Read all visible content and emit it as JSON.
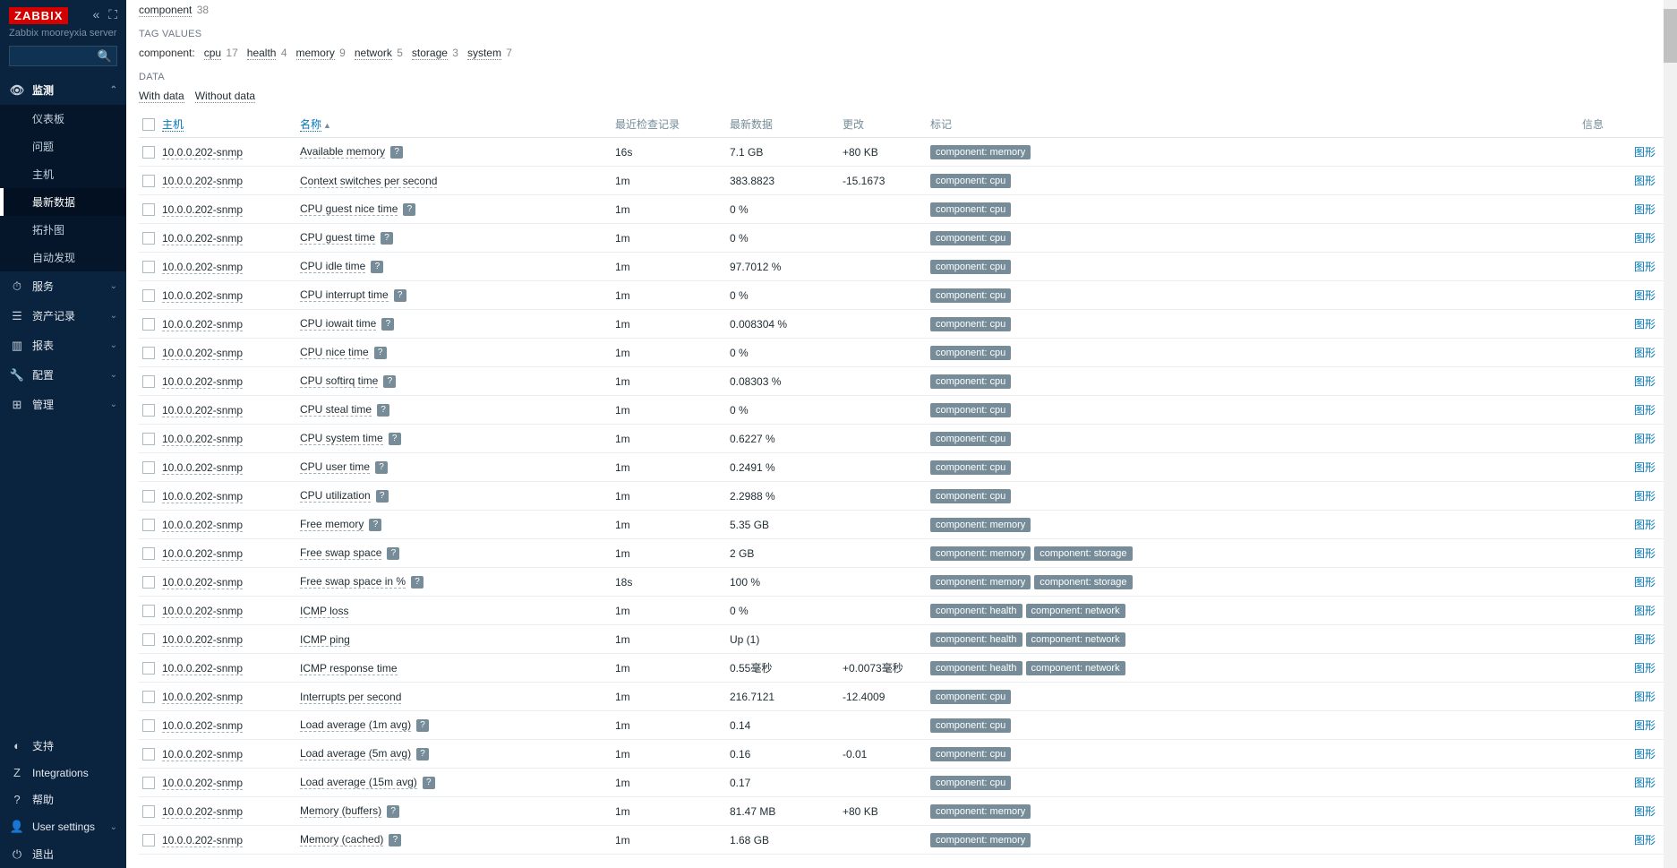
{
  "app": {
    "logo": "ZABBIX",
    "server_name": "Zabbix mooreyxia server"
  },
  "nav": {
    "monitoring": {
      "label": "监测",
      "items": {
        "dashboard": "仪表板",
        "problems": "问题",
        "hosts": "主机",
        "latest": "最新数据",
        "maps": "拓扑图",
        "discovery": "自动发现"
      }
    },
    "services": "服务",
    "inventory": "资产记录",
    "reports": "报表",
    "configuration": "配置",
    "administration": "管理",
    "support": "支持",
    "integrations": "Integrations",
    "help": "帮助",
    "user_settings": "User settings",
    "signout": "退出"
  },
  "filters": {
    "component_label": "component",
    "component_count": "38",
    "tag_values_label": "TAG VALUES",
    "row_label": "component:",
    "tags": [
      {
        "name": "cpu",
        "count": "17"
      },
      {
        "name": "health",
        "count": "4"
      },
      {
        "name": "memory",
        "count": "9"
      },
      {
        "name": "network",
        "count": "5"
      },
      {
        "name": "storage",
        "count": "3"
      },
      {
        "name": "system",
        "count": "7"
      }
    ],
    "data_label": "DATA",
    "with_data": "With data",
    "without_data": "Without data"
  },
  "headers": {
    "host": "主机",
    "name": "名称",
    "last_check": "最近检查记录",
    "last_value": "最新数据",
    "change": "更改",
    "tags": "标记",
    "info": "信息",
    "graph": "图形"
  },
  "host": "10.0.0.202-snmp",
  "rows": [
    {
      "name": "Available memory",
      "help": true,
      "check": "16s",
      "val": "7.1 GB",
      "chg": "+80 KB",
      "tags": [
        "component: memory"
      ]
    },
    {
      "name": "Context switches per second",
      "help": false,
      "check": "1m",
      "val": "383.8823",
      "chg": "-15.1673",
      "tags": [
        "component: cpu"
      ]
    },
    {
      "name": "CPU guest nice time",
      "help": true,
      "check": "1m",
      "val": "0 %",
      "chg": "",
      "tags": [
        "component: cpu"
      ]
    },
    {
      "name": "CPU guest time",
      "help": true,
      "check": "1m",
      "val": "0 %",
      "chg": "",
      "tags": [
        "component: cpu"
      ]
    },
    {
      "name": "CPU idle time",
      "help": true,
      "check": "1m",
      "val": "97.7012 %",
      "chg": "",
      "tags": [
        "component: cpu"
      ]
    },
    {
      "name": "CPU interrupt time",
      "help": true,
      "check": "1m",
      "val": "0 %",
      "chg": "",
      "tags": [
        "component: cpu"
      ]
    },
    {
      "name": "CPU iowait time",
      "help": true,
      "check": "1m",
      "val": "0.008304 %",
      "chg": "",
      "tags": [
        "component: cpu"
      ]
    },
    {
      "name": "CPU nice time",
      "help": true,
      "check": "1m",
      "val": "0 %",
      "chg": "",
      "tags": [
        "component: cpu"
      ]
    },
    {
      "name": "CPU softirq time",
      "help": true,
      "check": "1m",
      "val": "0.08303 %",
      "chg": "",
      "tags": [
        "component: cpu"
      ]
    },
    {
      "name": "CPU steal time",
      "help": true,
      "check": "1m",
      "val": "0 %",
      "chg": "",
      "tags": [
        "component: cpu"
      ]
    },
    {
      "name": "CPU system time",
      "help": true,
      "check": "1m",
      "val": "0.6227 %",
      "chg": "",
      "tags": [
        "component: cpu"
      ]
    },
    {
      "name": "CPU user time",
      "help": true,
      "check": "1m",
      "val": "0.2491 %",
      "chg": "",
      "tags": [
        "component: cpu"
      ]
    },
    {
      "name": "CPU utilization",
      "help": true,
      "check": "1m",
      "val": "2.2988 %",
      "chg": "",
      "tags": [
        "component: cpu"
      ]
    },
    {
      "name": "Free memory",
      "help": true,
      "check": "1m",
      "val": "5.35 GB",
      "chg": "",
      "tags": [
        "component: memory"
      ]
    },
    {
      "name": "Free swap space",
      "help": true,
      "check": "1m",
      "val": "2 GB",
      "chg": "",
      "tags": [
        "component: memory",
        "component: storage"
      ]
    },
    {
      "name": "Free swap space in %",
      "help": true,
      "check": "18s",
      "val": "100 %",
      "chg": "",
      "tags": [
        "component: memory",
        "component: storage"
      ]
    },
    {
      "name": "ICMP loss",
      "help": false,
      "check": "1m",
      "val": "0 %",
      "chg": "",
      "tags": [
        "component: health",
        "component: network"
      ]
    },
    {
      "name": "ICMP ping",
      "help": false,
      "check": "1m",
      "val": "Up (1)",
      "chg": "",
      "tags": [
        "component: health",
        "component: network"
      ]
    },
    {
      "name": "ICMP response time",
      "help": false,
      "check": "1m",
      "val": "0.55毫秒",
      "chg": "+0.0073毫秒",
      "tags": [
        "component: health",
        "component: network"
      ]
    },
    {
      "name": "Interrupts per second",
      "help": false,
      "check": "1m",
      "val": "216.7121",
      "chg": "-12.4009",
      "tags": [
        "component: cpu"
      ]
    },
    {
      "name": "Load average (1m avg)",
      "help": true,
      "check": "1m",
      "val": "0.14",
      "chg": "",
      "tags": [
        "component: cpu"
      ]
    },
    {
      "name": "Load average (5m avg)",
      "help": true,
      "check": "1m",
      "val": "0.16",
      "chg": "-0.01",
      "tags": [
        "component: cpu"
      ]
    },
    {
      "name": "Load average (15m avg)",
      "help": true,
      "check": "1m",
      "val": "0.17",
      "chg": "",
      "tags": [
        "component: cpu"
      ]
    },
    {
      "name": "Memory (buffers)",
      "help": true,
      "check": "1m",
      "val": "81.47 MB",
      "chg": "+80 KB",
      "tags": [
        "component: memory"
      ]
    },
    {
      "name": "Memory (cached)",
      "help": true,
      "check": "1m",
      "val": "1.68 GB",
      "chg": "",
      "tags": [
        "component: memory"
      ]
    }
  ]
}
